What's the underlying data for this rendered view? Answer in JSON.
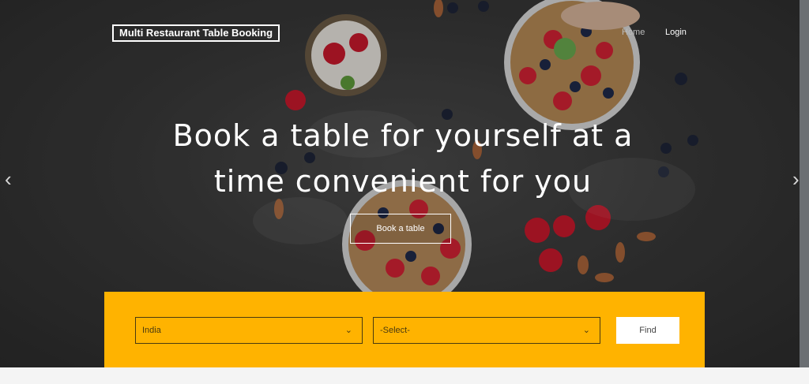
{
  "header": {
    "brand": "Multi Restaurant Table Booking",
    "nav": [
      {
        "label": "Home"
      },
      {
        "label": "Login"
      }
    ]
  },
  "hero": {
    "headline_line1": "Book a table for yourself at a",
    "headline_line2": "time convenient for you",
    "cta_label": "Book a table",
    "prev_icon": "chevron-left-icon",
    "next_icon": "chevron-right-icon"
  },
  "search": {
    "country_value": "India",
    "city_value": "-Select-",
    "find_label": "Find",
    "accent_color": "#ffb300"
  }
}
